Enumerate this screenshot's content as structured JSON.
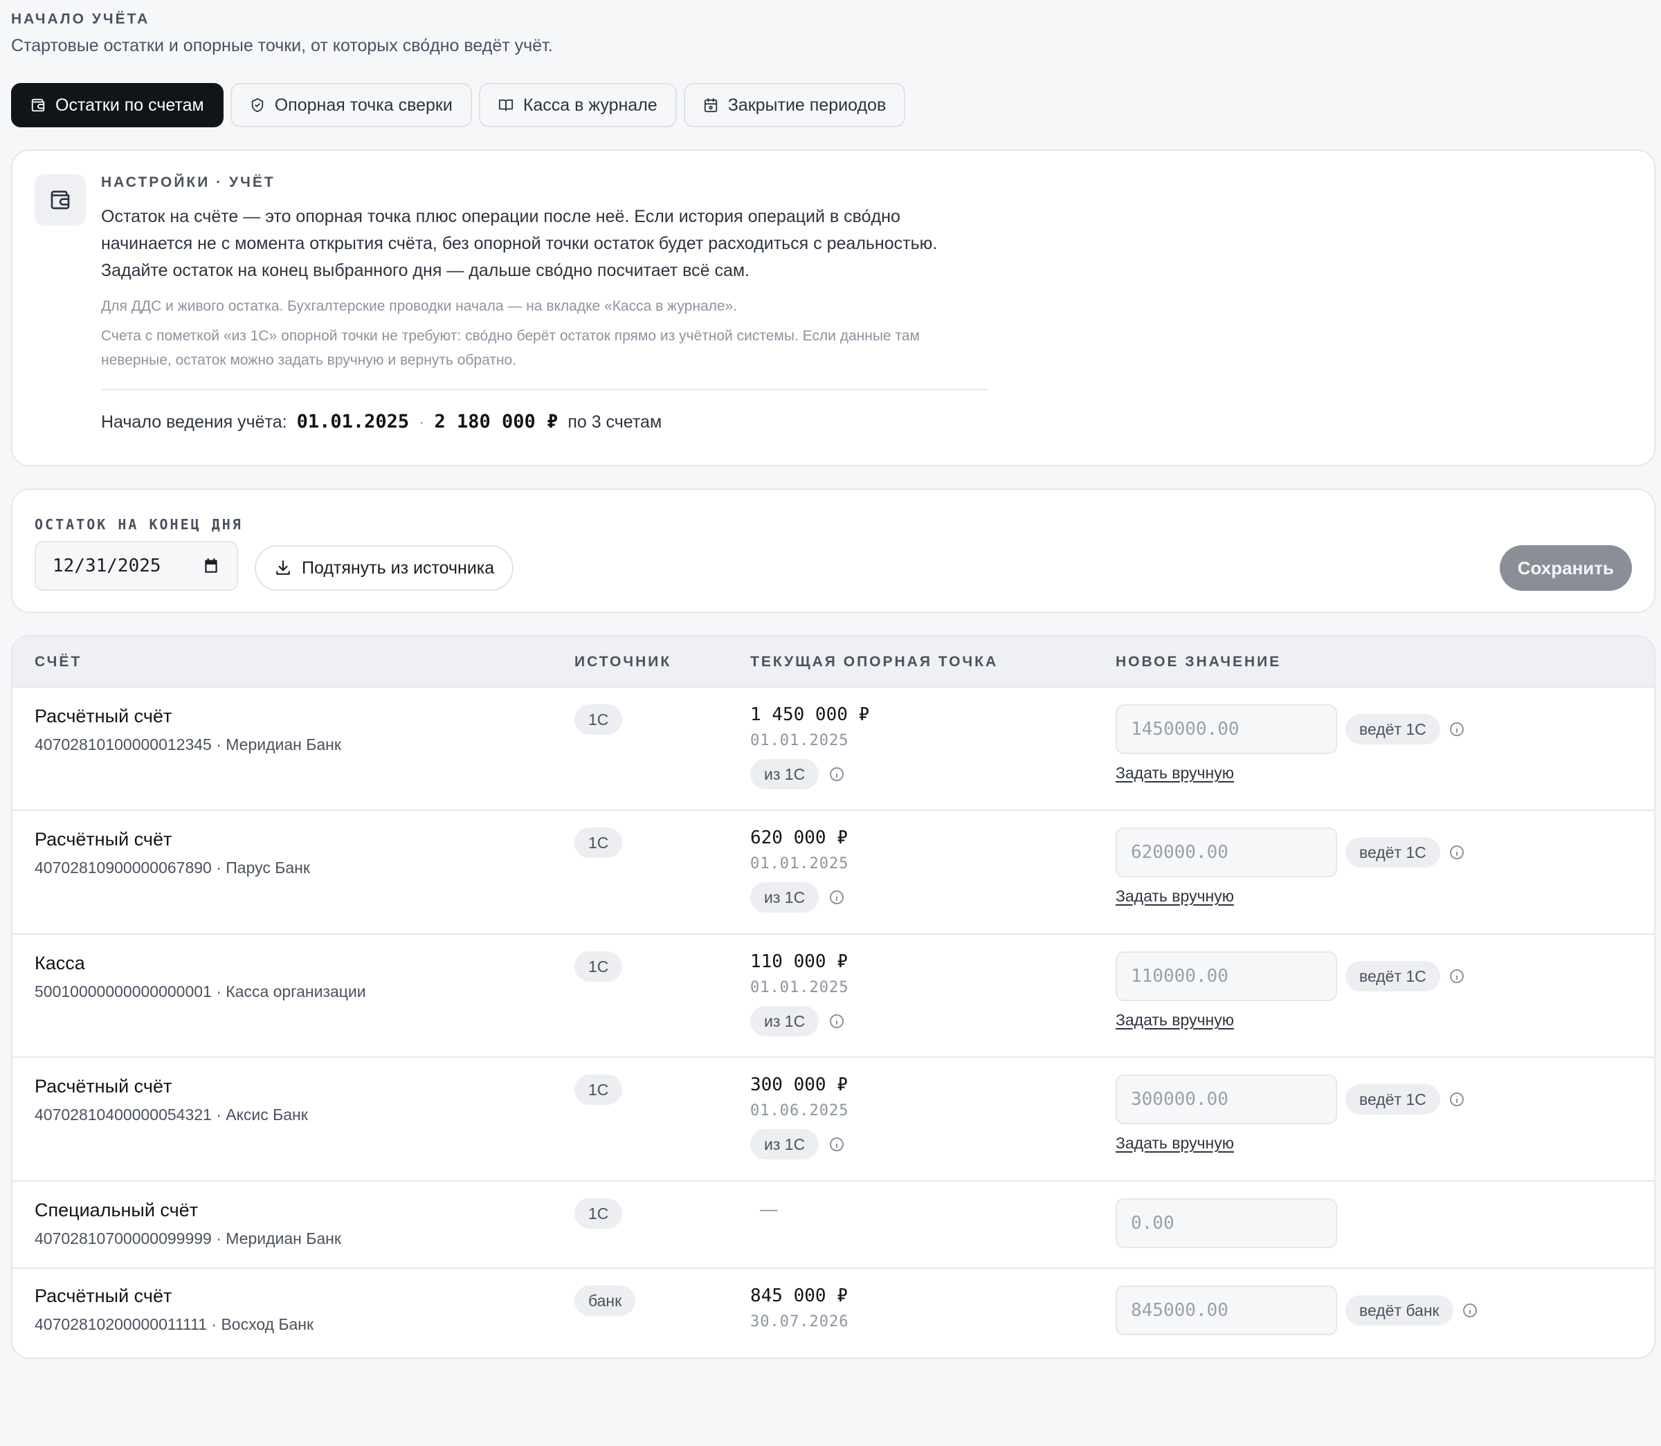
{
  "header": {
    "eyebrow": "НАЧАЛО УЧЁТА",
    "subtitle": "Стартовые остатки и опорные точки, от которых сво́дно ведёт учёт."
  },
  "tabs": [
    {
      "label": "Остатки по счетам",
      "icon": "wallet-icon",
      "active": true
    },
    {
      "label": "Опорная точка сверки",
      "icon": "shield-check-icon",
      "active": false
    },
    {
      "label": "Касса в журнале",
      "icon": "book-icon",
      "active": false
    },
    {
      "label": "Закрытие периодов",
      "icon": "calendar-icon",
      "active": false
    }
  ],
  "settings": {
    "eyebrow": "НАСТРОЙКИ · УЧЁТ",
    "main_text": "Остаток на счёте — это опорная точка плюс операции после неё. Если история операций в сво́дно начинается не с момента открытия счёта, без опорной точки остаток будет расходиться с реальностью. Задайте остаток на конец выбранного дня — дальше сво́дно посчитает всё сам.",
    "note_1": "Для ДДС и живого остатка. Бухгалтерские проводки начала — на вкладке «Касса в журнале».",
    "note_2": "Счета с пометкой «из 1С» опорной точки не требуют: сво́дно берёт остаток прямо из учётной системы. Если данные там неверные, остаток можно задать вручную и вернуть обратно.",
    "footer_label": "Начало ведения учёта:",
    "footer_date": "01.01.2025",
    "footer_sep": "·",
    "footer_total": "2 180 000 ₽",
    "footer_suffix": "по 3 счетам"
  },
  "date_panel": {
    "label": "ОСТАТОК НА КОНЕЦ ДНЯ",
    "date_value": "12/31/2025",
    "pull_label": "Подтянуть из источника",
    "save_label": "Сохранить"
  },
  "table": {
    "headers": {
      "account": "СЧЁТ",
      "source": "ИСТОЧНИК",
      "current": "ТЕКУЩАЯ ОПОРНАЯ ТОЧКА",
      "new_value": "НОВОЕ ЗНАЧЕНИЕ"
    },
    "manual_label": "Задать вручную",
    "rows": [
      {
        "name": "Расчётный счёт",
        "sub": "40702810100000012345 · Меридиан Банк",
        "source": "1С",
        "amount": "1 450 000 ₽",
        "date": "01.01.2025",
        "from": "из 1С",
        "placeholder": "1450000.00",
        "leads": "ведёт 1С"
      },
      {
        "name": "Расчётный счёт",
        "sub": "40702810900000067890 · Парус Банк",
        "source": "1С",
        "amount": "620 000 ₽",
        "date": "01.01.2025",
        "from": "из 1С",
        "placeholder": "620000.00",
        "leads": "ведёт 1С"
      },
      {
        "name": "Касса",
        "sub": "50010000000000000001 · Касса организации",
        "source": "1С",
        "amount": "110 000 ₽",
        "date": "01.01.2025",
        "from": "из 1С",
        "placeholder": "110000.00",
        "leads": "ведёт 1С"
      },
      {
        "name": "Расчётный счёт",
        "sub": "40702810400000054321 · Аксис Банк",
        "source": "1С",
        "amount": "300 000 ₽",
        "date": "01.06.2025",
        "from": "из 1С",
        "placeholder": "300000.00",
        "leads": "ведёт 1С"
      },
      {
        "name": "Специальный счёт",
        "sub": "40702810700000099999 · Меридиан Банк",
        "source": "1С",
        "empty": "—",
        "placeholder": "0.00"
      },
      {
        "name": "Расчётный счёт",
        "sub": "40702810200000011111 · Восход Банк",
        "source": "банк",
        "amount": "845 000 ₽",
        "date": "30.07.2026",
        "placeholder": "845000.00",
        "leads": "ведёт банк"
      }
    ]
  }
}
